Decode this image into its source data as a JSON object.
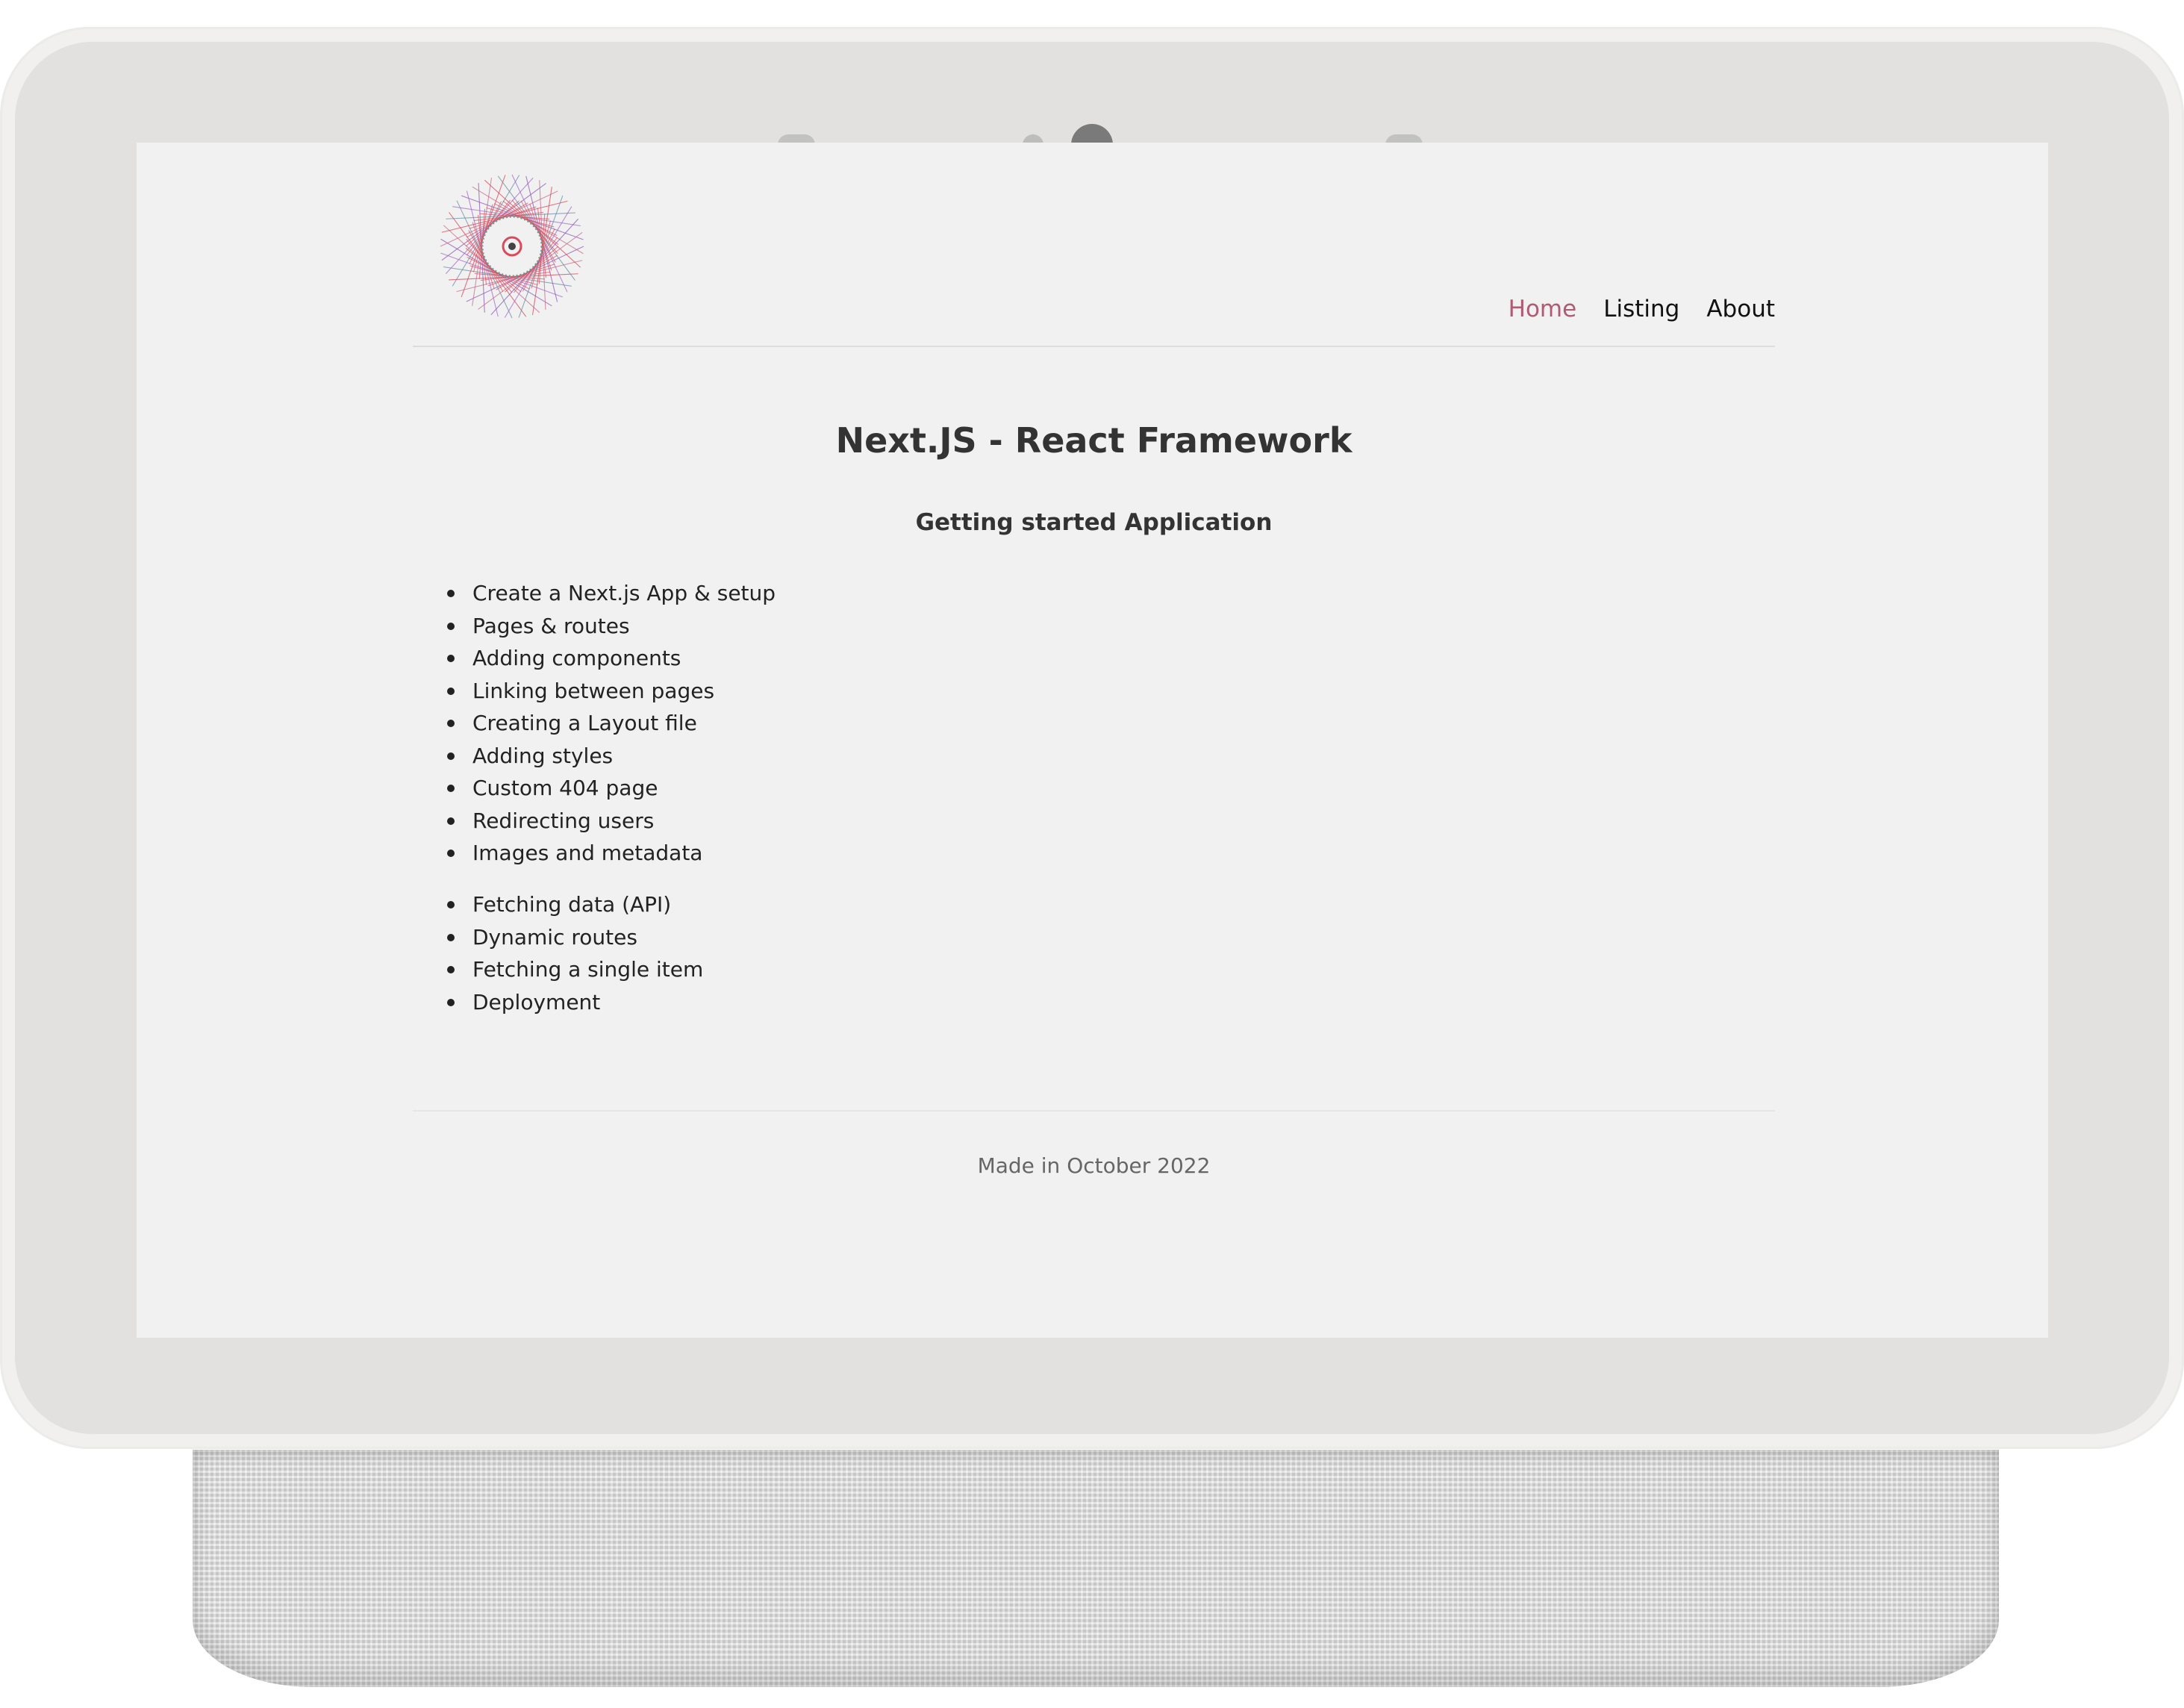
{
  "nav": {
    "items": [
      {
        "label": "Home",
        "active": true
      },
      {
        "label": "Listing",
        "active": false
      },
      {
        "label": "About",
        "active": false
      }
    ]
  },
  "main": {
    "title": "Next.JS - React Framework",
    "subtitle": "Getting started Application",
    "list_one": [
      "Create a Next.js App & setup",
      "Pages & routes",
      "Adding components",
      "Linking between pages",
      "Creating a Layout file",
      "Adding styles",
      "Custom 404 page",
      "Redirecting users",
      "Images and metadata"
    ],
    "list_two": [
      "Fetching data (API)",
      "Dynamic routes",
      "Fetching a single item",
      "Deployment"
    ]
  },
  "footer": {
    "text": "Made in October 2022"
  },
  "colors": {
    "active_nav": "#b05b74",
    "background": "#f1f1f1",
    "text": "#333333"
  },
  "icons": {
    "logo": "spirograph-logo-icon"
  }
}
